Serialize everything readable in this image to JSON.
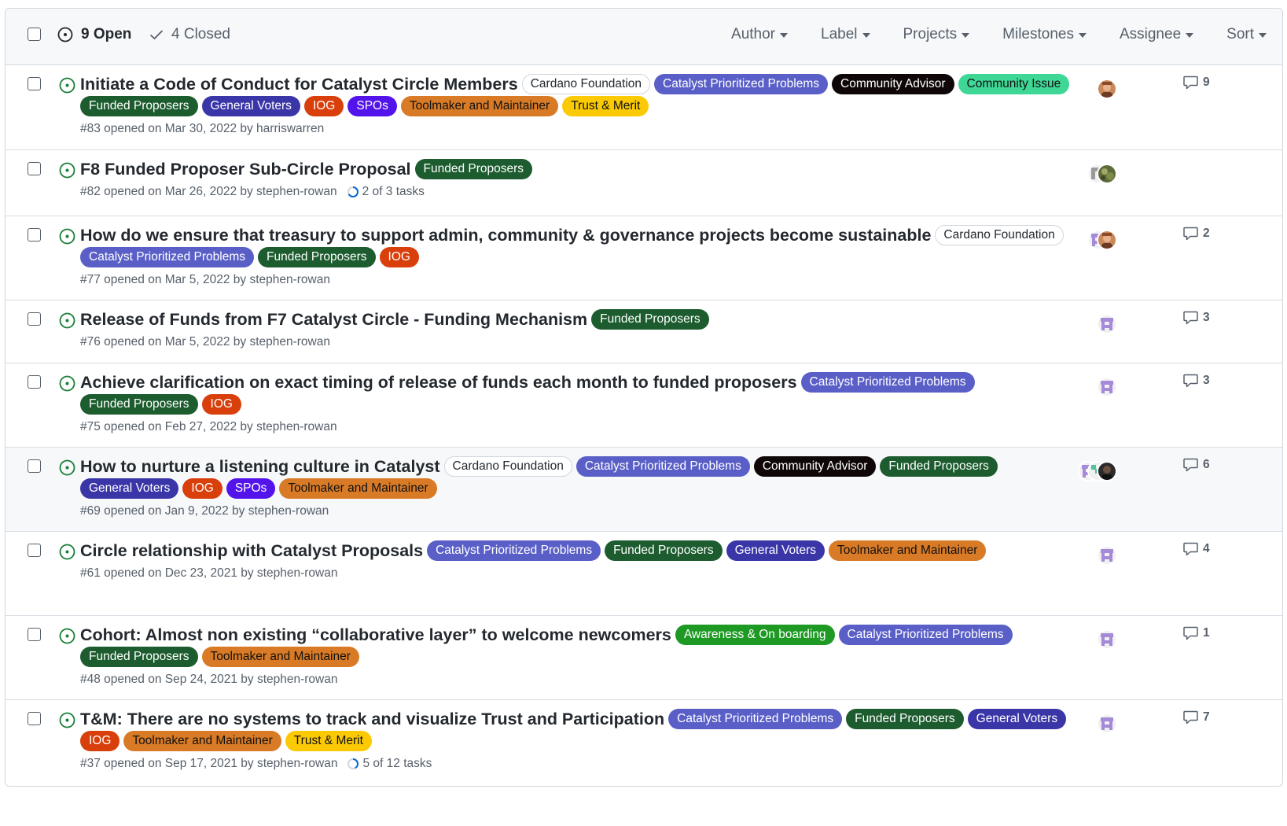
{
  "header": {
    "open_label": "9 Open",
    "closed_label": "4 Closed",
    "filters": [
      "Author",
      "Label",
      "Projects",
      "Milestones",
      "Assignee",
      "Sort"
    ]
  },
  "label_colors": {
    "Cardano Foundation": {
      "bg": "#ffffff",
      "fg": "#24292f"
    },
    "Catalyst Prioritized Problems": {
      "bg": "#5a5fc7",
      "fg": "#ffffff"
    },
    "Community Advisor": {
      "bg": "#0f0707",
      "fg": "#ffffff"
    },
    "Community Issue": {
      "bg": "#3fd796",
      "fg": "#111111"
    },
    "Funded Proposers": {
      "bg": "#1c5c2e",
      "fg": "#ffffff"
    },
    "General Voters": {
      "bg": "#3b36a8",
      "fg": "#ffffff"
    },
    "IOG": {
      "bg": "#d93f0b",
      "fg": "#ffffff"
    },
    "SPOs": {
      "bg": "#5314ec",
      "fg": "#ffffff"
    },
    "Toolmaker and Maintainer": {
      "bg": "#d97b26",
      "fg": "#111111"
    },
    "Trust & Merit": {
      "bg": "#fbca04",
      "fg": "#111111"
    },
    "Awareness & On boarding": {
      "bg": "#1e9a24",
      "fg": "#ffffff"
    }
  },
  "issues": [
    {
      "title": "Initiate a Code of Conduct for Catalyst Circle Members",
      "labels": [
        "Cardano Foundation",
        "Catalyst Prioritized Problems",
        "Community Advisor",
        "Community Issue",
        "Funded Proposers",
        "General Voters",
        "IOG",
        "SPOs",
        "Toolmaker and Maintainer",
        "Trust & Merit"
      ],
      "meta": "#83 opened on Mar 30, 2022 by harriswarren",
      "tasks": "",
      "comments": "9",
      "avatars": [
        "photo-orange"
      ],
      "highlight": false
    },
    {
      "title": "F8 Funded Proposer Sub-Circle Proposal",
      "labels": [
        "Funded Proposers"
      ],
      "meta": "#82 opened on Mar 26, 2022 by stephen-rowan",
      "tasks": "2 of 3 tasks",
      "task_progress": 0.67,
      "comments": "",
      "avatars": [
        "identicon-grey",
        "photo-green"
      ],
      "highlight": false
    },
    {
      "title": "How do we ensure that treasury to support admin, community & governance projects become sustainable",
      "labels": [
        "Cardano Foundation",
        "Catalyst Prioritized Problems",
        "Funded Proposers",
        "IOG"
      ],
      "meta": "#77 opened on Mar 5, 2022 by stephen-rowan",
      "tasks": "",
      "comments": "2",
      "avatars": [
        "identicon-purple",
        "photo-orange"
      ],
      "highlight": false
    },
    {
      "title": "Release of Funds from F7 Catalyst Circle - Funding Mechanism",
      "labels": [
        "Funded Proposers"
      ],
      "meta": "#76 opened on Mar 5, 2022 by stephen-rowan",
      "tasks": "",
      "comments": "3",
      "avatars": [
        "identicon-purple"
      ],
      "highlight": false
    },
    {
      "title": "Achieve clarification on exact timing of release of funds each month to funded proposers",
      "labels": [
        "Catalyst Prioritized Problems",
        "Funded Proposers",
        "IOG"
      ],
      "meta": "#75 opened on Feb 27, 2022 by stephen-rowan",
      "tasks": "",
      "comments": "3",
      "avatars": [
        "identicon-purple"
      ],
      "highlight": false
    },
    {
      "title": "How to nurture a listening culture in Catalyst",
      "labels": [
        "Cardano Foundation",
        "Catalyst Prioritized Problems",
        "Community Advisor",
        "Funded Proposers",
        "General Voters",
        "IOG",
        "SPOs",
        "Toolmaker and Maintainer"
      ],
      "meta": "#69 opened on Jan 9, 2022 by stephen-rowan",
      "tasks": "",
      "comments": "6",
      "avatars": [
        "identicon-purple",
        "identicon-green",
        "photo-dark"
      ],
      "highlight": true
    },
    {
      "title": "Circle relationship with Catalyst Proposals",
      "labels": [
        "Catalyst Prioritized Problems",
        "Funded Proposers",
        "General Voters",
        "Toolmaker and Maintainer"
      ],
      "meta": "#61 opened on Dec 23, 2021 by stephen-rowan",
      "tasks": "",
      "comments": "4",
      "avatars": [
        "identicon-purple"
      ],
      "highlight": false
    },
    {
      "title": "Cohort: Almost non existing “collaborative layer” to welcome newcomers",
      "labels": [
        "Awareness & On boarding",
        "Catalyst Prioritized Problems",
        "Funded Proposers",
        "Toolmaker and Maintainer"
      ],
      "meta": "#48 opened on Sep 24, 2021 by stephen-rowan",
      "tasks": "",
      "comments": "1",
      "avatars": [
        "identicon-purple"
      ],
      "highlight": false
    },
    {
      "title": "T&M: There are no systems to track and visualize Trust and Participation",
      "labels": [
        "Catalyst Prioritized Problems",
        "Funded Proposers",
        "General Voters",
        "IOG",
        "Toolmaker and Maintainer",
        "Trust & Merit"
      ],
      "meta": "#37 opened on Sep 17, 2021 by stephen-rowan",
      "tasks": "5 of 12 tasks",
      "task_progress": 0.42,
      "comments": "7",
      "avatars": [
        "identicon-purple"
      ],
      "highlight": false
    }
  ]
}
